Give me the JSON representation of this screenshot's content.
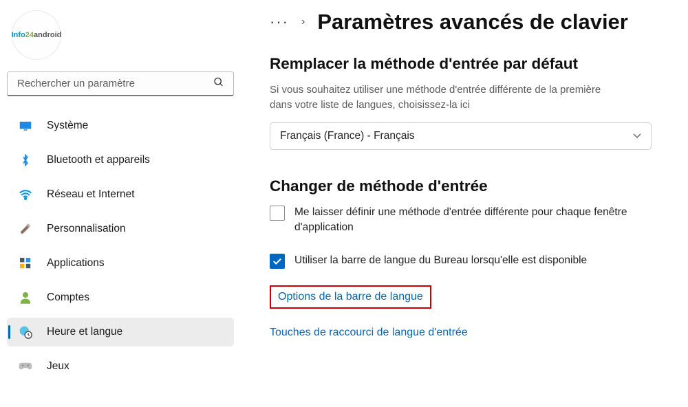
{
  "search": {
    "placeholder": "Rechercher un paramètre"
  },
  "nav": {
    "system": "Système",
    "bluetooth": "Bluetooth et appareils",
    "network": "Réseau et Internet",
    "personalize": "Personnalisation",
    "apps": "Applications",
    "accounts": "Comptes",
    "time": "Heure et langue",
    "gaming": "Jeux"
  },
  "header": {
    "title": "Paramètres avancés de clavier"
  },
  "section1": {
    "heading": "Remplacer la méthode d'entrée par défaut",
    "desc": "Si vous souhaitez utiliser une méthode d'entrée différente de la première dans votre liste de langues, choisissez-la ici",
    "select_value": "Français (France) - Français"
  },
  "section2": {
    "heading": "Changer de méthode d'entrée",
    "opt1": "Me laisser définir une méthode d'entrée différente pour chaque fenêtre d'application",
    "opt2": "Utiliser la barre de langue du Bureau lorsqu'elle est disponible",
    "link1": "Options de la barre de langue",
    "link2": "Touches de raccourci de langue d'entrée"
  }
}
